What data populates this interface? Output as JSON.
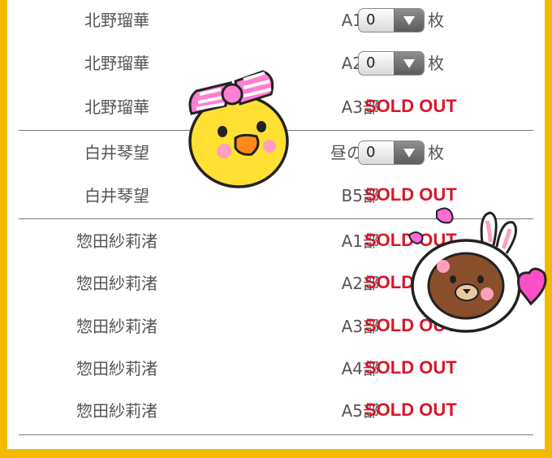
{
  "rows": [
    {
      "name": "北野瑠華",
      "part": "A1部",
      "quantity": "0",
      "unit": "枚"
    },
    {
      "name": "北野瑠華",
      "part": "A2部",
      "quantity": "0",
      "unit": "枚"
    },
    {
      "name": "北野瑠華",
      "part": "A3部",
      "status": "SOLD OUT"
    },
    {
      "name": "白井琴望",
      "part": "昼の部",
      "quantity": "0",
      "unit": "枚"
    },
    {
      "name": "白井琴望",
      "part": "B5部",
      "status": "SOLD OUT"
    },
    {
      "name": "惣田紗莉渚",
      "part": "A1部",
      "status": "SOLD OUT"
    },
    {
      "name": "惣田紗莉渚",
      "part": "A2部",
      "status": "SOLD OUT"
    },
    {
      "name": "惣田紗莉渚",
      "part": "A3部",
      "status": "SOLD OUT"
    },
    {
      "name": "惣田紗莉渚",
      "part": "A4部",
      "status": "SOLD OUT"
    },
    {
      "name": "惣田紗莉渚",
      "part": "A5部",
      "status": "SOLD OUT"
    }
  ],
  "colors": {
    "frame": "#f5b800",
    "sold_out": "#d4182a",
    "text": "#555555"
  },
  "icons": [
    "chick-sticker-icon",
    "bear-sticker-icon"
  ]
}
